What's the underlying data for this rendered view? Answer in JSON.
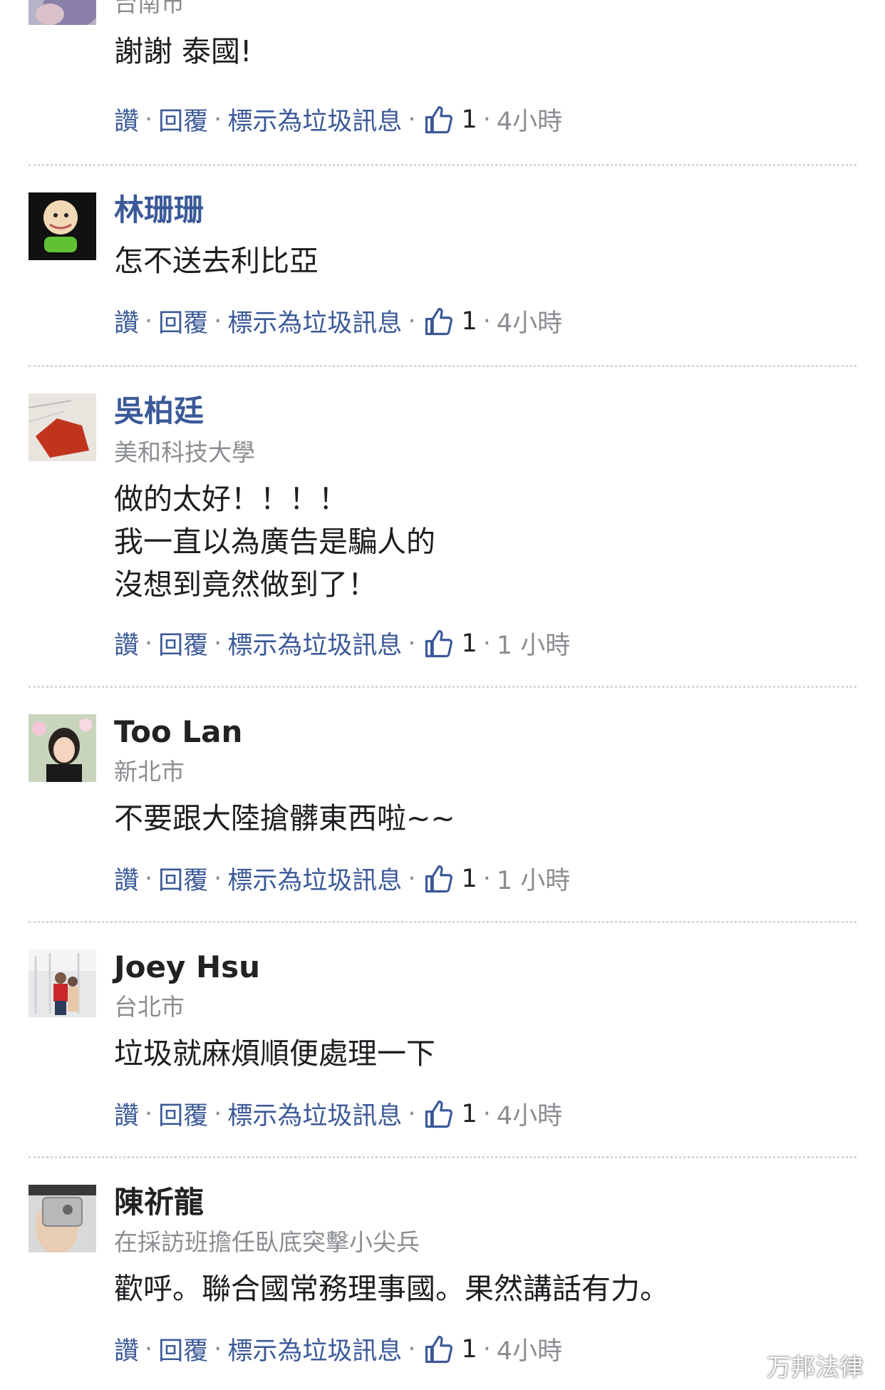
{
  "actions": {
    "like": "讚",
    "reply": "回覆",
    "spam": "標示為垃圾訊息",
    "sep": "·"
  },
  "colors": {
    "link": "#3b5998",
    "meta": "#8a8d91"
  },
  "comments": [
    {
      "location": "台南市",
      "text": [
        "謝謝 泰國!"
      ],
      "likes": "1",
      "time": "4小時"
    },
    {
      "name": "林珊珊",
      "text": [
        "怎不送去利比亞"
      ],
      "likes": "1",
      "time": "4小時"
    },
    {
      "name": "吳柏廷",
      "location": "美和科技大學",
      "text": [
        "做的太好！！！！",
        "我一直以為廣告是騙人的",
        "沒想到竟然做到了！"
      ],
      "likes": "1",
      "time": "1 小時"
    },
    {
      "name": "Too Lan",
      "location": "新北市",
      "text": [
        "不要跟大陸搶髒東西啦~~"
      ],
      "likes": "1",
      "time": "1 小時"
    },
    {
      "name": "Joey Hsu",
      "location": "台北市",
      "text": [
        "垃圾就麻煩順便處理一下"
      ],
      "likes": "1",
      "time": "4小時"
    },
    {
      "name": "陳祈龍",
      "location": "在採訪班擔任臥底突擊小尖兵",
      "text": [
        "歡呼。聯合國常務理事國。果然講話有力。"
      ],
      "likes": "1",
      "time": "4小時"
    }
  ],
  "watermark": {
    "label": "万邦法律",
    "icon": "wechat-icon"
  }
}
